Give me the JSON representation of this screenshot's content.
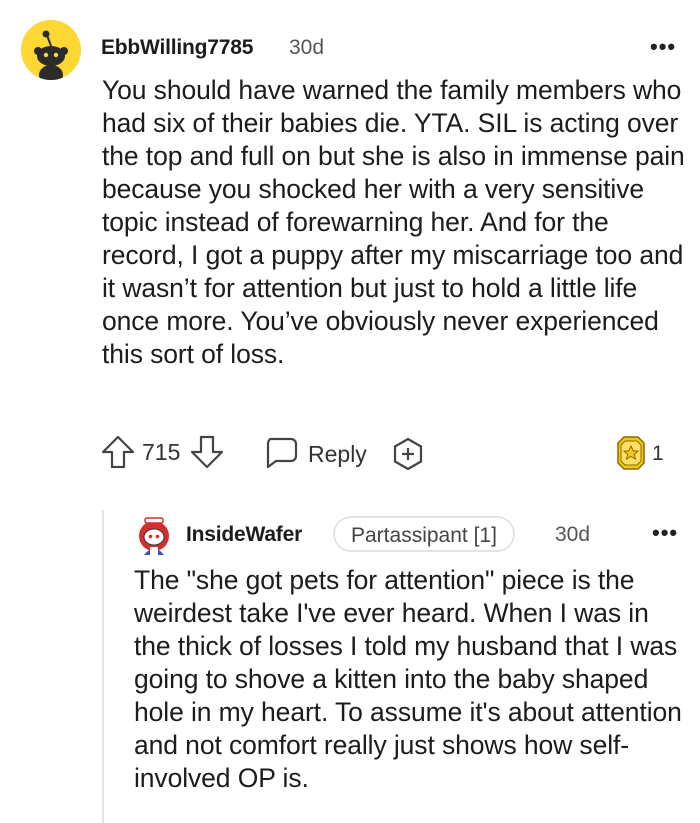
{
  "top_comment": {
    "username": "EbbWilling7785",
    "time": "30d",
    "more_menu": "•••",
    "body": "You should have warned the family members who had six of their babies die. YTA. SIL is acting over the top and full on but she is also in immense pain because you shocked her with a very sensitive topic instead of forewarning her. And for the record, I got a puppy after my miscarriage too and it wasn’t for attention but just to hold a little life once more. You’ve obviously never experienced this sort of loss.",
    "score": "715",
    "reply_label": "Reply",
    "award_count": "1",
    "avatar_icon": "snoo-avatar-icon",
    "avatar_color": "#fdd835"
  },
  "reply_comment": {
    "username": "InsideWafer",
    "flair": "Partassipant [1]",
    "time": "30d",
    "more_menu": "•••",
    "body": "The \"she got pets for attention\" piece is the weirdest take I've ever heard. When I was in the thick of losses I told my husband that I was going to shove a kitten into the baby shaped hole in my heart. To assume it's about attention and not comfort really just shows how self-involved OP is.",
    "avatar_icon": "snoo-red-hair-avatar-icon"
  },
  "colors": {
    "text": "#1c1c1c",
    "muted": "#555555",
    "award_gold": "#f5c518",
    "thread_line": "#e3e3e3"
  }
}
